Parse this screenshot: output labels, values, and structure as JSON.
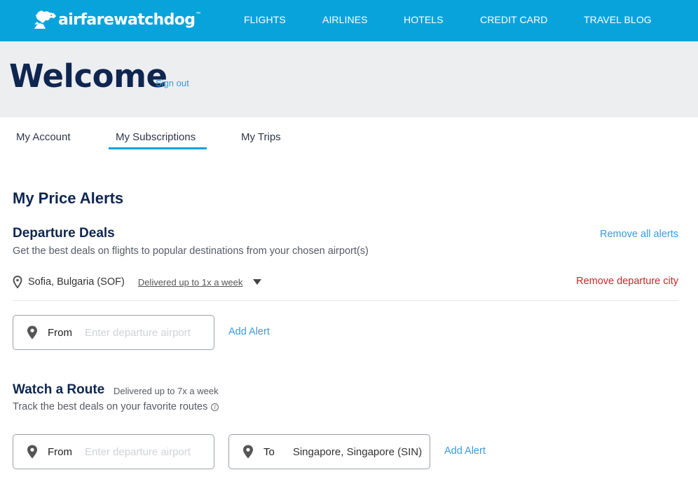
{
  "header": {
    "brand": "airfarewatchdog",
    "trademark": "™",
    "nav": [
      {
        "label": "FLIGHTS"
      },
      {
        "label": "AIRLINES"
      },
      {
        "label": "HOTELS"
      },
      {
        "label": "CREDIT CARD"
      },
      {
        "label": "TRAVEL BLOG"
      }
    ]
  },
  "hero": {
    "title": "Welcome",
    "sign_out": "Sign out"
  },
  "tabs": [
    {
      "label": "My Account",
      "active": false
    },
    {
      "label": "My Subscriptions",
      "active": true
    },
    {
      "label": "My Trips",
      "active": false
    }
  ],
  "price_alerts": {
    "title": "My Price Alerts",
    "departure_deals": {
      "title": "Departure Deals",
      "description": "Get the best deals on flights to popular destinations from your chosen airport(s)",
      "remove_all": "Remove all alerts",
      "cities": [
        {
          "name": "Sofia, Bulgaria (SOF)",
          "frequency": "Delivered up to 1x a week",
          "remove_label": "Remove departure city"
        }
      ],
      "from_field": {
        "label": "From",
        "placeholder": "Enter departure airport",
        "value": ""
      },
      "add_alert": "Add Alert"
    },
    "watch_route": {
      "title": "Watch a Route",
      "frequency": "Delivered up to 7x a week",
      "description": "Track the best deals on your favorite routes",
      "info_icon": "i",
      "from_field": {
        "label": "From",
        "placeholder": "Enter departure airport",
        "value": ""
      },
      "to_field": {
        "label": "To",
        "placeholder": "",
        "value": "Singapore, Singapore (SIN)"
      },
      "add_alert": "Add Alert"
    }
  },
  "colors": {
    "brand_blue": "#09a3dc",
    "navy": "#0f2650",
    "link_blue": "#3a9ad9",
    "danger_red": "#c62828",
    "hero_bg": "#edeef0"
  }
}
